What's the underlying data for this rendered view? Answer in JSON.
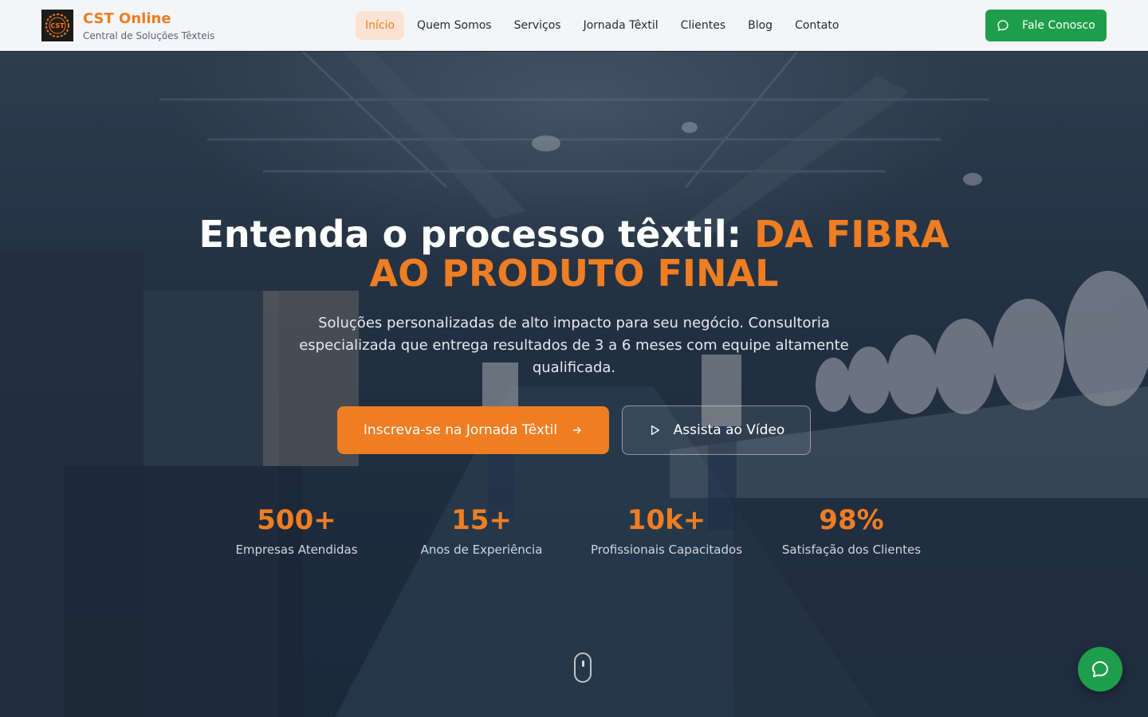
{
  "brand": {
    "logo_text": "CST",
    "name": "CST Online",
    "tagline": "Central de Soluções Têxteis"
  },
  "nav": {
    "items": [
      {
        "label": "Início",
        "active": true
      },
      {
        "label": "Quem Somos",
        "active": false
      },
      {
        "label": "Serviços",
        "active": false
      },
      {
        "label": "Jornada Têxtil",
        "active": false
      },
      {
        "label": "Clientes",
        "active": false
      },
      {
        "label": "Blog",
        "active": false
      },
      {
        "label": "Contato",
        "active": false
      }
    ],
    "cta_label": "Fale Conosco",
    "cta_icon": "chat-bubble-icon"
  },
  "hero": {
    "headline_white": "Entenda o processo têxtil: ",
    "headline_accent_1": "DA FIBRA",
    "headline_accent_2": "AO PRODUTO FINAL",
    "subtitle": "Soluções personalizadas de alto impacto para seu negócio. Consultoria especializada que entrega resultados de 3 a 6 meses com equipe altamente qualificada.",
    "primary_button": "Inscreva-se na Jornada Têxtil",
    "secondary_button": "Assista ao Vídeo",
    "stats": [
      {
        "value": "500+",
        "label": "Empresas Atendidas"
      },
      {
        "value": "15+",
        "label": "Anos de Experiência"
      },
      {
        "value": "10k+",
        "label": "Profissionais Capacitados"
      },
      {
        "value": "98%",
        "label": "Satisfação dos Clientes"
      }
    ]
  },
  "colors": {
    "accent": "#ef7d22",
    "green": "#1e9e4a",
    "nav_bg": "#f4f5f7"
  }
}
